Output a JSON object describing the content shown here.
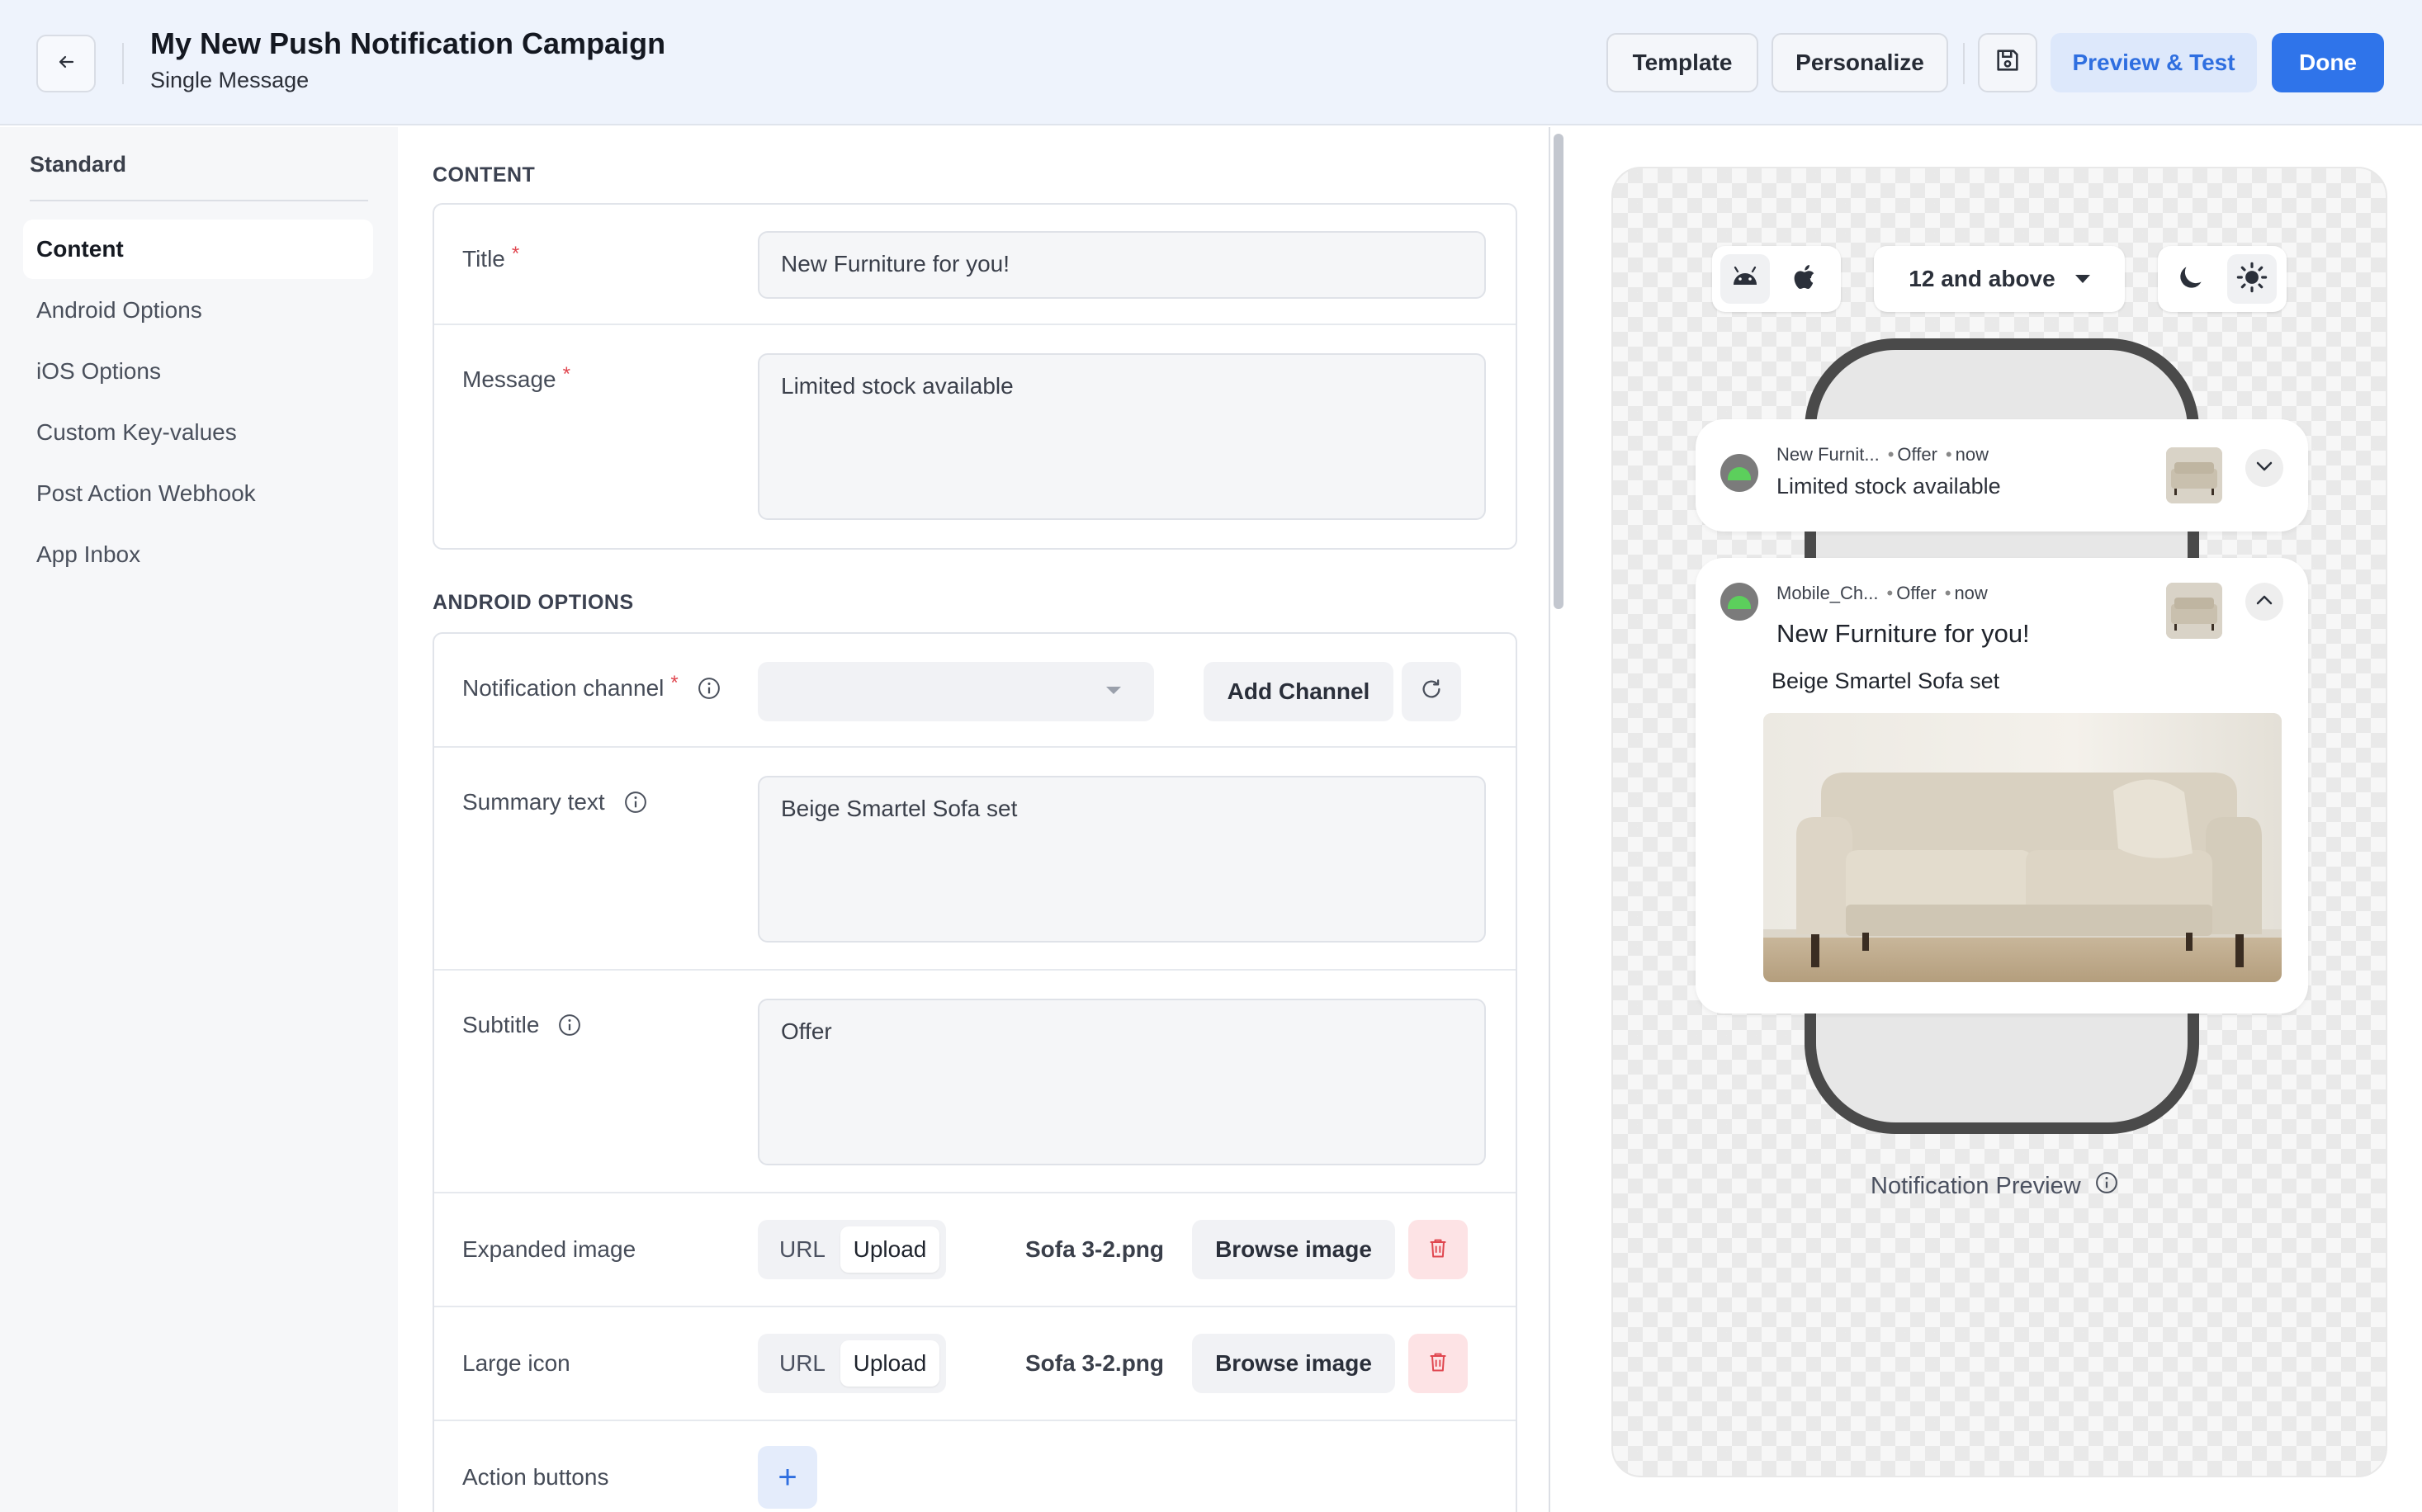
{
  "header": {
    "title": "My New Push Notification Campaign",
    "subtitle": "Single Message",
    "buttons": {
      "template": "Template",
      "personalize": "Personalize",
      "preview_test": "Preview & Test",
      "done": "Done"
    },
    "icons": {
      "back": "arrow-left-icon",
      "save": "save-icon"
    }
  },
  "sidebar": {
    "heading": "Standard",
    "items": [
      {
        "label": "Content",
        "active": true
      },
      {
        "label": "Android Options",
        "active": false
      },
      {
        "label": "iOS Options",
        "active": false
      },
      {
        "label": "Custom Key-values",
        "active": false
      },
      {
        "label": "Post Action Webhook",
        "active": false
      },
      {
        "label": "App Inbox",
        "active": false
      }
    ]
  },
  "content_section": {
    "heading": "CONTENT",
    "title_label": "Title",
    "title_value": "New Furniture for you!",
    "message_label": "Message",
    "message_value": "Limited stock available",
    "required_mark": "*"
  },
  "android_section": {
    "heading": "ANDROID OPTIONS",
    "channel_label": "Notification channel",
    "channel_value": "",
    "add_channel": "Add Channel",
    "summary_label": "Summary text",
    "summary_value": "Beige Smartel Sofa set",
    "subtitle_label": "Subtitle",
    "subtitle_value": "Offer",
    "expanded_image_label": "Expanded image",
    "large_icon_label": "Large icon",
    "seg_url": "URL",
    "seg_upload": "Upload",
    "expanded_file": "Sofa 3-2.png",
    "large_icon_file": "Sofa 3-2.png",
    "browse": "Browse image",
    "action_buttons_label": "Action buttons",
    "plus": "+"
  },
  "preview": {
    "version": "12 and above",
    "os_options": [
      "android-icon",
      "apple-icon"
    ],
    "theme_options": [
      "moon-icon",
      "sun-icon"
    ],
    "collapsed": {
      "app": "New Furnit...",
      "subtitle": "Offer",
      "time": "now",
      "text": "Limited stock available"
    },
    "expanded": {
      "app": "Mobile_Ch...",
      "subtitle": "Offer",
      "time": "now",
      "title": "New Furniture for you!",
      "summary": "Beige Smartel Sofa set"
    },
    "caption": "Notification Preview"
  },
  "colors": {
    "accent": "#2f74ea",
    "header_bg": "#eef3fc",
    "danger_bg": "#fde3e5",
    "danger": "#e0464f",
    "android_green": "#5ccf5c"
  }
}
